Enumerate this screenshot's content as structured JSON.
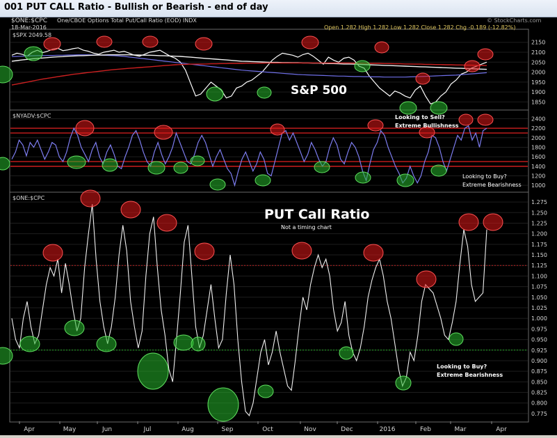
{
  "window_title": "001 PUT CALL Ratio - Bullish or Bearish - end of day",
  "header": {
    "symbol_line": "$ONE:$CPC",
    "description": "One/CBOE Options Total Put/Call Ratio (EOD)  INDX",
    "date": "18-Mar-2016",
    "spx_label": "$SPX 2049.58",
    "watermark": "© StockCharts.com",
    "ohlc": "Open 1.282  High 1.282  Low 1.282  Close 1.282  Chg -0.189 (-12.82%)"
  },
  "colors": {
    "background": "#000000",
    "panel_border": "#6a6a6a",
    "price_line": "#ffffff",
    "ma_blue": "#6f6fe8",
    "ma_white": "#f2f2f2",
    "ma_red": "#cc2020",
    "breadth_line": "#7d7df0",
    "threshold_red": "#e02020",
    "ratio_line": "#f0f0f0",
    "red_marker": "#e01818",
    "green_marker": "#27b72b",
    "axis_text": "#d8d8d8"
  },
  "annotations": {
    "sp500": "S&P 500",
    "sell_1": "Looking to Sell?",
    "sell_2": "Extreme Bullishness",
    "buy_mid_1": "Looking to Buy?",
    "buy_mid_2": "Extreme Bearishness",
    "putcall_title": "PUT Call Ratio",
    "not_timing": "Not a timing chart",
    "buy_low_1": "Looking to Buy?",
    "buy_low_2": "Extreme Bearishness"
  },
  "chart_data": [
    {
      "type": "line",
      "panel": "top",
      "series": [
        {
          "name": "$SPX",
          "values": [
            2085,
            2095,
            2090,
            2080,
            2100,
            2110,
            2098,
            2105,
            2115,
            2120,
            2108,
            2112,
            2118,
            2122,
            2110,
            2105,
            2095,
            2090,
            2100,
            2105,
            2110,
            2100,
            2105,
            2095,
            2085,
            2080,
            2090,
            2100,
            2105,
            2110,
            2095,
            2080,
            2070,
            2050,
            2010,
            1945,
            1880,
            1890,
            1920,
            1950,
            1930,
            1910,
            1870,
            1880,
            1920,
            1930,
            1950,
            1960,
            1980,
            2000,
            2030,
            2060,
            2080,
            2095,
            2090,
            2085,
            2075,
            2088,
            2095,
            2080,
            2060,
            2040,
            2075,
            2060,
            2050,
            2070,
            2075,
            2060,
            2030,
            2020,
            1980,
            1950,
            1920,
            1900,
            1880,
            1905,
            1895,
            1880,
            1870,
            1910,
            1930,
            1880,
            1840,
            1850,
            1880,
            1900,
            1940,
            1960,
            1990,
            2000,
            2020,
            2030,
            2040,
            2050
          ]
        },
        {
          "name": "",
          "values": [
            2078,
            2079,
            2080,
            2081,
            2082,
            2083,
            2083,
            2084,
            2084,
            2085,
            2085,
            2086,
            2086,
            2087,
            2087,
            2087,
            2086,
            2086,
            2085,
            2084,
            2083,
            2081,
            2079,
            2076,
            2073,
            2070,
            2067,
            2064,
            2061,
            2058,
            2055,
            2052,
            2049,
            2046,
            2043,
            2040,
            2037,
            2034,
            2031,
            2028,
            2025,
            2022,
            2019,
            2016,
            2013,
            2010,
            2008,
            2006,
            2004,
            2002,
            2000,
            1998,
            1996,
            1994,
            1992,
            1990,
            1988,
            1987,
            1986,
            1985,
            1984,
            1983,
            1982,
            1981,
            1980,
            1980,
            1979,
            1978,
            1978,
            1977,
            1977,
            1976,
            1976,
            1975,
            1975,
            1975,
            1975,
            1975,
            1976,
            1977,
            1978,
            1979,
            1980,
            1981,
            1982,
            1983,
            1984,
            1985,
            1987,
            1989,
            1991,
            1993,
            1995,
            1997
          ]
        },
        {
          "name": "",
          "values": [
            2055,
            2058,
            2061,
            2064,
            2067,
            2069,
            2071,
            2073,
            2075,
            2077,
            2078,
            2080,
            2081,
            2082,
            2083,
            2084,
            2085,
            2086,
            2086,
            2087,
            2087,
            2087,
            2087,
            2087,
            2086,
            2086,
            2085,
            2085,
            2084,
            2083,
            2082,
            2081,
            2080,
            2079,
            2077,
            2075,
            2073,
            2071,
            2069,
            2067,
            2065,
            2063,
            2061,
            2059,
            2057,
            2055,
            2054,
            2053,
            2052,
            2051,
            2050,
            2049,
            2049,
            2048,
            2048,
            2047,
            2047,
            2046,
            2046,
            2045,
            2045,
            2044,
            2043,
            2043,
            2042,
            2041,
            2041,
            2040,
            2039,
            2038,
            2037,
            2036,
            2035,
            2034,
            2033,
            2032,
            2031,
            2030,
            2029,
            2028,
            2027,
            2026,
            2025,
            2024,
            2023,
            2022,
            2021,
            2020,
            2019,
            2018,
            2017,
            2016,
            2015,
            2014
          ]
        },
        {
          "name": "",
          "values": [
            1935,
            1940,
            1945,
            1950,
            1955,
            1960,
            1965,
            1969,
            1973,
            1977,
            1981,
            1985,
            1989,
            1992,
            1995,
            1998,
            2001,
            2004,
            2007,
            2010,
            2013,
            2015,
            2017,
            2019,
            2021,
            2023,
            2025,
            2027,
            2029,
            2031,
            2033,
            2035,
            2037,
            2038,
            2039,
            2040,
            2040,
            2041,
            2041,
            2042,
            2042,
            2043,
            2043,
            2044,
            2044,
            2044,
            2045,
            2045,
            2045,
            2045,
            2046,
            2046,
            2046,
            2046,
            2046,
            2046,
            2046,
            2046,
            2046,
            2046,
            2046,
            2046,
            2046,
            2046,
            2046,
            2046,
            2046,
            2045,
            2045,
            2045,
            2044,
            2044,
            2044,
            2043,
            2043,
            2042,
            2042,
            2041,
            2041,
            2040,
            2040,
            2039,
            2039,
            2038,
            2038,
            2037,
            2037,
            2036,
            2036,
            2035,
            2035,
            2034,
            2034,
            2033
          ]
        }
      ],
      "yticks": [
        1850,
        1900,
        1950,
        2000,
        2050,
        2100,
        2150
      ],
      "ylim": [
        1820,
        2170
      ]
    },
    {
      "type": "line",
      "panel": "middle",
      "title": "$NYADV:$CPC",
      "series": [
        {
          "name": "$NYADV:$CPC",
          "values": [
            1550,
            1700,
            1950,
            1850,
            1620,
            1900,
            1800,
            1950,
            1750,
            1550,
            1700,
            1900,
            1850,
            1600,
            1500,
            1700,
            2000,
            2200,
            2050,
            1800,
            1650,
            1500,
            1750,
            1900,
            1600,
            1450,
            1700,
            1850,
            1650,
            1400,
            1350,
            1600,
            1800,
            2050,
            2150,
            1950,
            1700,
            1500,
            1400,
            1700,
            1900,
            1650,
            1450,
            1600,
            1800,
            2100,
            1900,
            1700,
            1500,
            1450,
            1650,
            1900,
            2050,
            1900,
            1650,
            1400,
            1600,
            1750,
            1550,
            1350,
            1250,
            1000,
            1300,
            1550,
            1700,
            1500,
            1300,
            1450,
            1700,
            1550,
            1250,
            1200,
            1500,
            1800,
            2100,
            2150,
            1950,
            2100,
            1900,
            1700,
            1500,
            1650,
            1900,
            1750,
            1550,
            1400,
            1500,
            1800,
            2000,
            1850,
            1550,
            1450,
            1700,
            1900,
            1800,
            1600,
            1300,
            1100,
            1450,
            1750,
            1900,
            2150,
            2050,
            1800,
            1600,
            1400,
            1250,
            1050,
            1150,
            1400,
            1200,
            1050,
            1200,
            1500,
            1700,
            2050,
            2000,
            1800,
            1500,
            1300,
            1550,
            1800,
            2050,
            1950,
            2200,
            2250,
            1950,
            2100,
            1800,
            2150,
            2200
          ]
        }
      ],
      "threshold_lines": [
        1400,
        1500,
        2100,
        2200
      ],
      "yticks": [
        1000,
        1200,
        1400,
        1600,
        1800,
        2000,
        2200,
        2400
      ],
      "ylim": [
        900,
        2480
      ]
    },
    {
      "type": "line",
      "panel": "bottom",
      "title": "$ONE:$CPC",
      "series": [
        {
          "name": "$ONE:$CPC",
          "values": [
            1.0,
            0.95,
            0.93,
            1.0,
            1.04,
            0.98,
            0.94,
            0.96,
            1.02,
            1.08,
            1.12,
            1.1,
            1.14,
            1.06,
            1.13,
            1.08,
            1.02,
            0.97,
            1.0,
            1.12,
            1.2,
            1.27,
            1.14,
            1.04,
            0.98,
            0.94,
            0.98,
            1.05,
            1.15,
            1.22,
            1.16,
            1.04,
            0.98,
            0.93,
            0.97,
            1.1,
            1.2,
            1.24,
            1.12,
            1.02,
            0.96,
            0.88,
            0.85,
            0.95,
            1.06,
            1.18,
            1.22,
            1.1,
            0.98,
            0.93,
            0.96,
            1.02,
            1.08,
            1.0,
            0.93,
            0.95,
            1.06,
            1.15,
            1.08,
            0.95,
            0.85,
            0.78,
            0.77,
            0.8,
            0.86,
            0.92,
            0.95,
            0.89,
            0.92,
            0.97,
            0.92,
            0.88,
            0.84,
            0.83,
            0.9,
            0.98,
            1.05,
            1.02,
            1.08,
            1.12,
            1.15,
            1.12,
            1.14,
            1.1,
            1.02,
            0.97,
            0.99,
            1.04,
            0.96,
            0.92,
            0.9,
            0.93,
            0.98,
            1.05,
            1.09,
            1.12,
            1.14,
            1.1,
            1.04,
            1.0,
            0.94,
            0.88,
            0.84,
            0.86,
            0.92,
            0.9,
            0.96,
            1.04,
            1.08,
            1.07,
            1.06,
            1.03,
            1.0,
            0.96,
            0.95,
            0.99,
            1.04,
            1.13,
            1.21,
            1.17,
            1.08,
            1.04,
            1.05,
            1.06,
            1.21
          ]
        }
      ],
      "threshold_lines": [
        1.125,
        0.925
      ],
      "yticks": [
        0.775,
        0.8,
        0.825,
        0.85,
        0.875,
        0.9,
        0.925,
        0.95,
        0.975,
        1.0,
        1.025,
        1.05,
        1.075,
        1.1,
        1.125,
        1.15,
        1.175,
        1.2,
        1.225,
        1.25,
        1.275
      ],
      "ytick_labels": [
        "0.775",
        "0.800",
        "0.825",
        "0.850",
        "0.875",
        "0.900",
        "0.925",
        "0.950",
        "0.975",
        "1.000",
        "1.025",
        "1.050",
        "1.075",
        "1.100",
        "1.125",
        "1.150",
        "1.175",
        "1.200",
        "1.225",
        "1.250",
        "1.275"
      ],
      "ylim": [
        0.76,
        1.29
      ]
    }
  ],
  "xaxis": {
    "labels": [
      "Apr",
      "May",
      "Jun",
      "Jul",
      "Aug",
      "Sep",
      "Oct",
      "Nov",
      "Dec",
      "2016",
      "Feb",
      "Mar",
      "Apr"
    ]
  }
}
